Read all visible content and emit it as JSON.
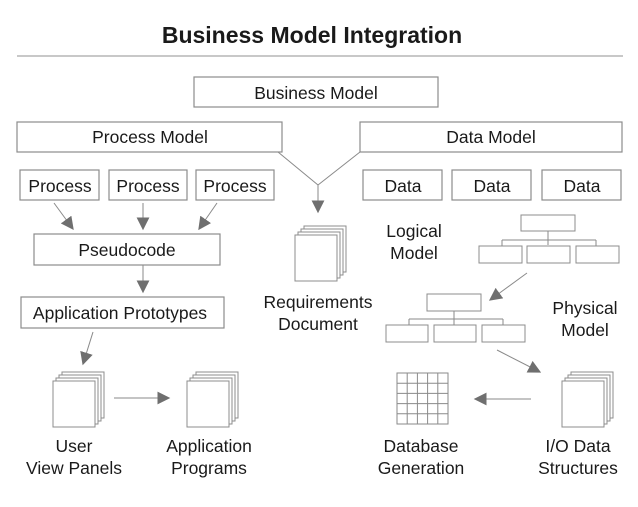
{
  "title": "Business Model Integration",
  "boxes": {
    "business_model": "Business Model",
    "process_model": "Process Model",
    "data_model": "Data Model",
    "processes": [
      "Process",
      "Process",
      "Process"
    ],
    "data_items": [
      "Data",
      "Data",
      "Data"
    ],
    "pseudocode": "Pseudocode",
    "application_prototypes": "Application Prototypes"
  },
  "labels": {
    "requirements_document": [
      "Requirements",
      "Document"
    ],
    "logical_model": [
      "Logical",
      "Model"
    ],
    "physical_model": [
      "Physical",
      "Model"
    ],
    "user_view_panels": [
      "User",
      "View Panels"
    ],
    "application_programs": [
      "Application",
      "Programs"
    ],
    "database_generation": [
      "Database",
      "Generation"
    ],
    "io_data_structures": [
      "I/O Data",
      "Structures"
    ]
  },
  "colors": {
    "text": "#1a1a1a",
    "border": "#8c8c8c",
    "arrow": "#6f6f6f",
    "background": "#ffffff"
  }
}
